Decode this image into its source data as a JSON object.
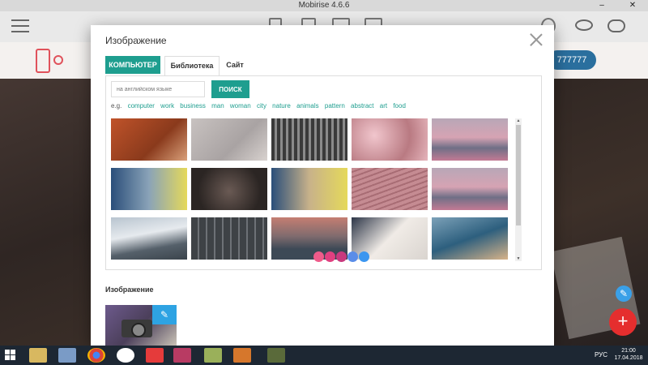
{
  "window": {
    "title": "Mobirise 4.6.6",
    "minimize": "–",
    "close": "✕"
  },
  "site": {
    "phone_button": "777777"
  },
  "modal": {
    "title": "Изображение",
    "tabs": [
      {
        "label": "КОМПЬЮТЕР",
        "active": true
      },
      {
        "label": "Библиотека",
        "active": false
      },
      {
        "label": "Сайт",
        "active": false
      }
    ],
    "search": {
      "placeholder": "на английском языке",
      "button": "ПОИСК"
    },
    "suggestions_prefix": "e.g.",
    "suggestions": [
      "computer",
      "work",
      "business",
      "man",
      "woman",
      "city",
      "nature",
      "animals",
      "pattern",
      "abstract",
      "art",
      "food"
    ],
    "images": [
      [
        "phone-autumn",
        "device-grey",
        "skyscraper",
        "blossom",
        "beach-pink"
      ],
      [
        "man-laptop",
        "hands-dark",
        "man-laptop-2",
        "wood-pink",
        "beach-pink-2"
      ],
      [
        "mountain-snow",
        "building-facade",
        "mountain-dusk",
        "hands-phone",
        "phone-table"
      ]
    ],
    "image_section_label": "Изображение"
  },
  "colors": {
    "accent": "#1e9e8f",
    "fab_red": "#e52e2e",
    "edit_blue": "#2ea3e3",
    "loader": [
      "#ef5b8a",
      "#e04080",
      "#c83a7e",
      "#5a8de8",
      "#3b96f0"
    ]
  },
  "taskbar": {
    "language": "РУС",
    "time": "21:00",
    "date": "17.04.2018"
  }
}
